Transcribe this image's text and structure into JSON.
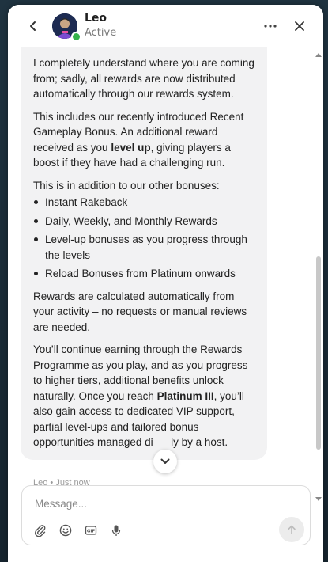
{
  "header": {
    "contact_name": "Leo",
    "contact_status": "Active",
    "back_icon": "chevron-left-icon",
    "more_icon": "ellipsis-icon",
    "close_icon": "close-icon"
  },
  "message": {
    "paragraph_1": "I completely understand where you are coming from; sadly, all rewards are now distributed automatically through our rewards system.",
    "paragraph_2_before": "This includes our recently introduced Recent Gameplay Bonus. An additional reward received as you ",
    "paragraph_2_bold": "level up",
    "paragraph_2_after": ", giving players a boost if they have had a challenging run.",
    "paragraph_3": "This is in addition to our other bonuses:",
    "bonuses": [
      "Instant Rakeback",
      "Daily, Weekly, and Monthly Rewards",
      "Level-up bonuses as you progress through the levels",
      "Reload Bonuses from Platinum onwards"
    ],
    "paragraph_4": "Rewards are calculated automatically from your activity – no requests or manual reviews are needed.",
    "paragraph_5_before": "You’ll continue earning through the Rewards Programme as you play, and as you progress to higher tiers, additional benefits unlock naturally. Once you reach ",
    "paragraph_5_bold": "Platinum III",
    "paragraph_5_after": ", you’ll also gain access to dedicated VIP support, partial level-ups and tailored bonus opportunities managed di",
    "paragraph_5_hidden": "rect",
    "paragraph_5_tail": "ly by a host.",
    "meta": "Leo • Just now"
  },
  "composer": {
    "placeholder": "Message...",
    "value": "",
    "tools": [
      "paperclip-icon",
      "emoji-icon",
      "gif-icon",
      "microphone-icon"
    ],
    "send_icon": "arrow-up-icon"
  },
  "colors": {
    "bubble_bg": "#f2f2f3",
    "status_online": "#35b24a",
    "panel_bg": "#ffffff"
  }
}
